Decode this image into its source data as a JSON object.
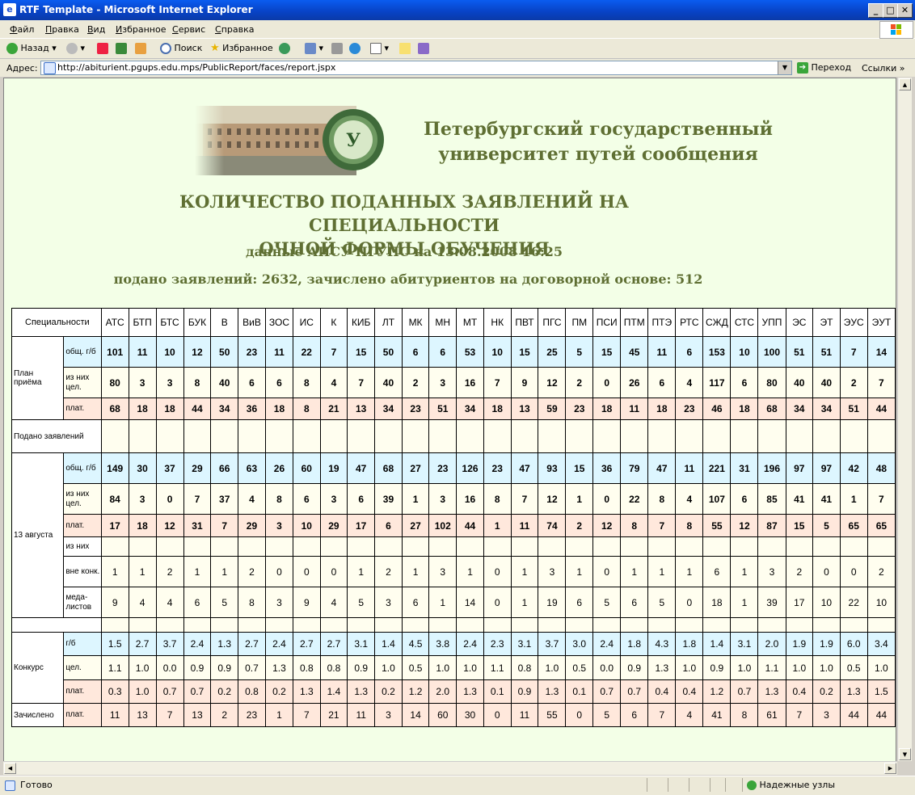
{
  "window": {
    "title": "RTF Template - Microsoft Internet Explorer"
  },
  "menu": [
    "Файл",
    "Правка",
    "Вид",
    "Избранное",
    "Сервис",
    "Справка"
  ],
  "toolbar": {
    "back": "Назад",
    "search": "Поиск",
    "favorites": "Избранное"
  },
  "address": {
    "label": "Адрес:",
    "url": "http://abiturient.pgups.edu.mps/PublicReport/faces/report.jspx",
    "go": "Переход",
    "links": "Ссылки"
  },
  "status": {
    "text": "Готово",
    "zone": "Надежные узлы"
  },
  "page": {
    "university_line1": "Петербургский государственный",
    "university_line2": "университет путей сообщения",
    "heading_line1": "КОЛИЧЕСТВО ПОДАННЫХ ЗАЯВЛЕНИЙ НА СПЕЦИАЛЬНОСТИ",
    "heading_line2": "ОЧНОЙ ФОРМЫ ОБУЧЕНИЯ",
    "data_note": "данные АИСУ ПГУПС на  13.08.2008 16:25",
    "summary": "подано заявлений: 2632, зачислено абитуриентов на договорной основе: 512"
  },
  "table": {
    "spec_header": "Специальности",
    "specialties": [
      "АТС",
      "БТП",
      "БТС",
      "БУК",
      "В",
      "ВиВ",
      "ЗОС",
      "ИС",
      "К",
      "КИБ",
      "ЛТ",
      "МК",
      "МН",
      "МТ",
      "НК",
      "ПВТ",
      "ПГС",
      "ПМ",
      "ПСИ",
      "ПТМ",
      "ПТЭ",
      "РТС",
      "СЖД",
      "СТС",
      "УПП",
      "ЭС",
      "ЭТ",
      "ЭУС",
      "ЭУТ"
    ],
    "groups": {
      "plan": "План приёма",
      "submitted": "Подано заявлений",
      "date": "13 августа",
      "competition": "Конкурс",
      "enrolled": "Зачислено"
    },
    "sub": {
      "total": "общ. г/б",
      "target": "из них цел.",
      "paid": "плат.",
      "of_them": "из них",
      "no_comp": "вне конк.",
      "medals": "меда-листов",
      "gb": "г/б",
      "cel": "цел."
    },
    "plan_total": [
      "101",
      "11",
      "10",
      "12",
      "50",
      "23",
      "11",
      "22",
      "7",
      "15",
      "50",
      "6",
      "6",
      "53",
      "10",
      "15",
      "25",
      "5",
      "15",
      "45",
      "11",
      "6",
      "153",
      "10",
      "100",
      "51",
      "51",
      "7",
      "14"
    ],
    "plan_target": [
      "80",
      "3",
      "3",
      "8",
      "40",
      "6",
      "6",
      "8",
      "4",
      "7",
      "40",
      "2",
      "3",
      "16",
      "7",
      "9",
      "12",
      "2",
      "0",
      "26",
      "6",
      "4",
      "117",
      "6",
      "80",
      "40",
      "40",
      "2",
      "7"
    ],
    "plan_paid": [
      "68",
      "18",
      "18",
      "44",
      "34",
      "36",
      "18",
      "8",
      "21",
      "13",
      "34",
      "23",
      "51",
      "34",
      "18",
      "13",
      "59",
      "23",
      "18",
      "11",
      "18",
      "23",
      "46",
      "18",
      "68",
      "34",
      "34",
      "51",
      "44"
    ],
    "app_total": [
      "149",
      "30",
      "37",
      "29",
      "66",
      "63",
      "26",
      "60",
      "19",
      "47",
      "68",
      "27",
      "23",
      "126",
      "23",
      "47",
      "93",
      "15",
      "36",
      "79",
      "47",
      "11",
      "221",
      "31",
      "196",
      "97",
      "97",
      "42",
      "48"
    ],
    "app_target": [
      "84",
      "3",
      "0",
      "7",
      "37",
      "4",
      "8",
      "6",
      "3",
      "6",
      "39",
      "1",
      "3",
      "16",
      "8",
      "7",
      "12",
      "1",
      "0",
      "22",
      "8",
      "4",
      "107",
      "6",
      "85",
      "41",
      "41",
      "1",
      "7"
    ],
    "app_paid": [
      "17",
      "18",
      "12",
      "31",
      "7",
      "29",
      "3",
      "10",
      "29",
      "17",
      "6",
      "27",
      "102",
      "44",
      "1",
      "11",
      "74",
      "2",
      "12",
      "8",
      "7",
      "8",
      "55",
      "12",
      "87",
      "15",
      "5",
      "65",
      "65"
    ],
    "app_nocomp": [
      "1",
      "1",
      "2",
      "1",
      "1",
      "2",
      "0",
      "0",
      "0",
      "1",
      "2",
      "1",
      "3",
      "1",
      "0",
      "1",
      "3",
      "1",
      "0",
      "1",
      "1",
      "1",
      "6",
      "1",
      "3",
      "2",
      "0",
      "0",
      "2"
    ],
    "app_medals": [
      "9",
      "4",
      "4",
      "6",
      "5",
      "8",
      "3",
      "9",
      "4",
      "5",
      "3",
      "6",
      "1",
      "14",
      "0",
      "1",
      "19",
      "6",
      "5",
      "6",
      "5",
      "0",
      "18",
      "1",
      "39",
      "17",
      "10",
      "22",
      "10"
    ],
    "comp_gb": [
      "1.5",
      "2.7",
      "3.7",
      "2.4",
      "1.3",
      "2.7",
      "2.4",
      "2.7",
      "2.7",
      "3.1",
      "1.4",
      "4.5",
      "3.8",
      "2.4",
      "2.3",
      "3.1",
      "3.7",
      "3.0",
      "2.4",
      "1.8",
      "4.3",
      "1.8",
      "1.4",
      "3.1",
      "2.0",
      "1.9",
      "1.9",
      "6.0",
      "3.4"
    ],
    "comp_cel": [
      "1.1",
      "1.0",
      "0.0",
      "0.9",
      "0.9",
      "0.7",
      "1.3",
      "0.8",
      "0.8",
      "0.9",
      "1.0",
      "0.5",
      "1.0",
      "1.0",
      "1.1",
      "0.8",
      "1.0",
      "0.5",
      "0.0",
      "0.9",
      "1.3",
      "1.0",
      "0.9",
      "1.0",
      "1.1",
      "1.0",
      "1.0",
      "0.5",
      "1.0"
    ],
    "comp_paid": [
      "0.3",
      "1.0",
      "0.7",
      "0.7",
      "0.2",
      "0.8",
      "0.2",
      "1.3",
      "1.4",
      "1.3",
      "0.2",
      "1.2",
      "2.0",
      "1.3",
      "0.1",
      "0.9",
      "1.3",
      "0.1",
      "0.7",
      "0.7",
      "0.4",
      "0.4",
      "1.2",
      "0.7",
      "1.3",
      "0.4",
      "0.2",
      "1.3",
      "1.5"
    ],
    "enrolled_paid": [
      "11",
      "13",
      "7",
      "13",
      "2",
      "23",
      "1",
      "7",
      "21",
      "11",
      "3",
      "14",
      "60",
      "30",
      "0",
      "11",
      "55",
      "0",
      "5",
      "6",
      "7",
      "4",
      "41",
      "8",
      "61",
      "7",
      "3",
      "44",
      "44"
    ]
  }
}
